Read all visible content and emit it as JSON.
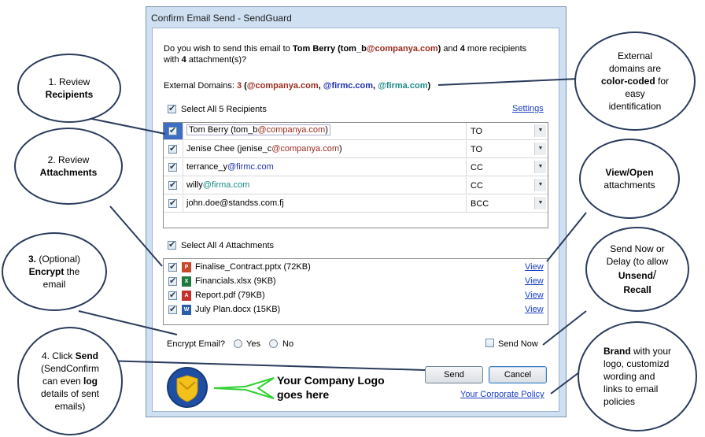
{
  "window": {
    "title": "Confirm Email Send - SendGuard"
  },
  "question": {
    "p1": "Do you wish to send this email to ",
    "recipient_name": "Tom Berry",
    "recipient_open": " (tom_b",
    "recipient_domain": "@companya.com",
    "recipient_close": ")",
    "p2": " and ",
    "more_count": "4",
    "p3": " more recipients",
    "line2a": "with ",
    "attach_count": "4",
    "line2b": " attachment(s)?"
  },
  "external": {
    "label": "External Domains: ",
    "count": "3",
    "open": " (",
    "d1": "@companya.com",
    "sep1": ", ",
    "d2": "@firmc.com",
    "sep2": ", ",
    "d3": "@firma.com",
    "close": ")"
  },
  "recipients": {
    "select_all_label": "Select All 5 Recipients",
    "settings_link": "Settings",
    "rows": [
      {
        "pre": "Tom Berry (tom_b",
        "domain": "@companya.com",
        "post": ")",
        "type": "TO"
      },
      {
        "pre": "Jenise Chee (jenise_c",
        "domain": "@companya.com",
        "post": ")",
        "type": "TO"
      },
      {
        "pre": "terrance_y",
        "domain": "@firmc.com",
        "post": "",
        "type": "CC"
      },
      {
        "pre": "willy",
        "domain": "@firma.com",
        "post": "",
        "type": "CC"
      },
      {
        "pre": "john.doe@standss.com.fj",
        "domain": "",
        "post": "",
        "type": "BCC"
      }
    ]
  },
  "attachments": {
    "select_all_label": "Select All 4 Attachments",
    "view_label": "View",
    "items": [
      {
        "name": "Finalise_Contract.pptx (72KB)",
        "icon": "powerpoint-icon",
        "color": "#c8482a",
        "glyph": "P"
      },
      {
        "name": "Financials.xlsx (9KB)",
        "icon": "excel-icon",
        "color": "#1e7a3c",
        "glyph": "X"
      },
      {
        "name": "Report.pdf (79KB)",
        "icon": "pdf-icon",
        "color": "#c4302b",
        "glyph": "A"
      },
      {
        "name": "July Plan.docx (15KB)",
        "icon": "word-icon",
        "color": "#2b5faa",
        "glyph": "W"
      }
    ]
  },
  "encrypt": {
    "label": "Encrypt Email?",
    "yes": "Yes",
    "no": "No"
  },
  "send_now": {
    "label": "Send Now"
  },
  "buttons": {
    "send": "Send",
    "cancel": "Cancel"
  },
  "policy_link": "Your Corporate Policy",
  "logo_text": {
    "line1": "Your Company Logo",
    "line2": "goes here"
  },
  "callouts": {
    "c1": {
      "a": "1. Review",
      "b": "Recipients"
    },
    "c2": {
      "a": "2. Review",
      "b": "Attachments"
    },
    "c3": {
      "num": "3.",
      "a": " (Optional)",
      "b": "Encrypt",
      "c": " the",
      "d": "email"
    },
    "c4": {
      "a": "4. Click ",
      "b": "Send",
      "c": "(SendConfirm",
      "d": "can even ",
      "e": "log",
      "f": "details of sent",
      "g": "emails)"
    },
    "c5": {
      "a": "External",
      "b": "domains are",
      "c": "color-coded",
      "d": " for",
      "e": "easy",
      "f": "identification"
    },
    "c6": {
      "a": "View/Open",
      "b": "attachments"
    },
    "c7": {
      "a": "Send Now or",
      "b": "Delay (to allow",
      "c": "Unsend",
      "d": "/",
      "e": "Recall"
    },
    "c8": {
      "a": "Brand",
      "b": " with your",
      "c": "logo, customizd",
      "d": "wording and",
      "e": "links to email",
      "f": "policies"
    }
  },
  "colors": {
    "internal": "#9b2b1f",
    "firmc": "#1d2fae",
    "firma": "#1a8b86",
    "accent": "#2a3b5c"
  }
}
